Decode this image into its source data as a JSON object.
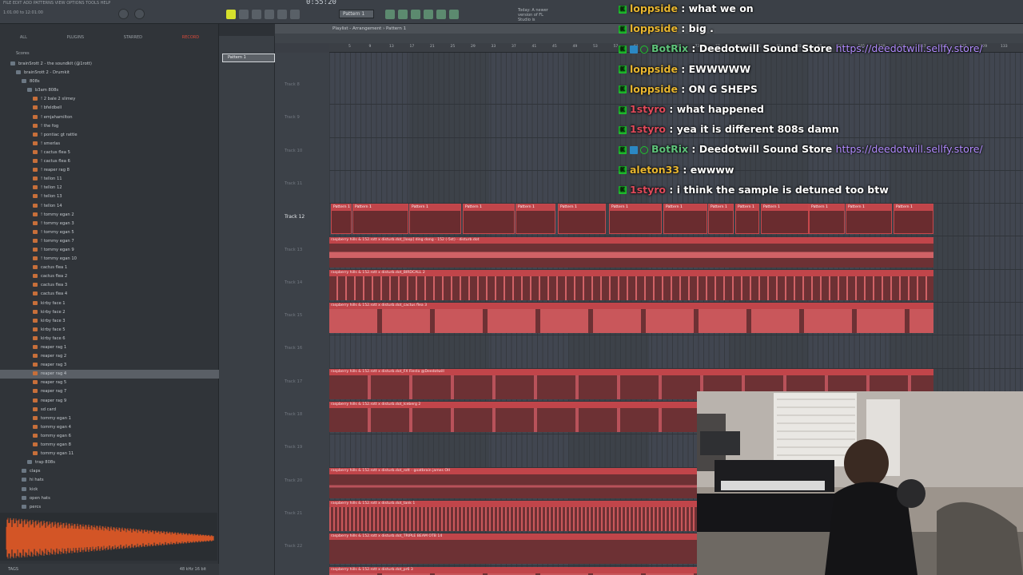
{
  "window": {
    "menu_text": "FILE EDIT ADD PATTERNS VIEW OPTIONS TOOLS HELP",
    "time_display": "0:55:20",
    "pattern_selector": "Pattern 1",
    "snap": "Line",
    "clock_line1": "1:01:00 to 12:01:00",
    "tip_text": "Today: A newer version of FL Studio is"
  },
  "browser": {
    "tabs": [
      {
        "label": "ALL"
      },
      {
        "label": "PLUGINS"
      },
      {
        "label": "STARRED"
      },
      {
        "label": "RECORD"
      }
    ],
    "scores_label": "Scores",
    "tree": [
      {
        "label": "brainSrott 2 - the soundkit (@1rott)",
        "indent": 1,
        "type": "folder"
      },
      {
        "label": "brainSrott 2 - Drumkit",
        "indent": 2,
        "type": "folder"
      },
      {
        "label": "808s",
        "indent": 3,
        "type": "folder"
      },
      {
        "label": "b3am 808s",
        "indent": 4,
        "type": "folder"
      },
      {
        "label": "! 2 bale 2 slimey",
        "indent": 5,
        "type": "wav"
      },
      {
        "label": "! bfeldbell",
        "indent": 5,
        "type": "wav"
      },
      {
        "label": "! emjahamilton",
        "indent": 5,
        "type": "wav"
      },
      {
        "label": "! the fog",
        "indent": 5,
        "type": "wav"
      },
      {
        "label": "! pontiac gt rattle",
        "indent": 5,
        "type": "wav"
      },
      {
        "label": "! smerlas",
        "indent": 5,
        "type": "wav"
      },
      {
        "label": "! cactus flea 5",
        "indent": 5,
        "type": "wav"
      },
      {
        "label": "! cactus flea 6",
        "indent": 5,
        "type": "wav"
      },
      {
        "label": "! reaper rag 8",
        "indent": 5,
        "type": "wav"
      },
      {
        "label": "! tellon 11",
        "indent": 5,
        "type": "wav"
      },
      {
        "label": "! tellon 12",
        "indent": 5,
        "type": "wav"
      },
      {
        "label": "! tellon 13",
        "indent": 5,
        "type": "wav"
      },
      {
        "label": "! tellon 14",
        "indent": 5,
        "type": "wav"
      },
      {
        "label": "! tommy egan 2",
        "indent": 5,
        "type": "wav"
      },
      {
        "label": "! tommy egan 3",
        "indent": 5,
        "type": "wav"
      },
      {
        "label": "! tommy egan 5",
        "indent": 5,
        "type": "wav"
      },
      {
        "label": "! tommy egan 7",
        "indent": 5,
        "type": "wav"
      },
      {
        "label": "! tommy egan 9",
        "indent": 5,
        "type": "wav"
      },
      {
        "label": "! tommy egan 10",
        "indent": 5,
        "type": "wav"
      },
      {
        "label": "cactus flea 1",
        "indent": 5,
        "type": "wav"
      },
      {
        "label": "cactus flea 2",
        "indent": 5,
        "type": "wav"
      },
      {
        "label": "cactus flea 3",
        "indent": 5,
        "type": "wav"
      },
      {
        "label": "cactus flea 4",
        "indent": 5,
        "type": "wav"
      },
      {
        "label": "kirby face 1",
        "indent": 5,
        "type": "wav"
      },
      {
        "label": "kirby face 2",
        "indent": 5,
        "type": "wav"
      },
      {
        "label": "kirby face 3",
        "indent": 5,
        "type": "wav"
      },
      {
        "label": "kirby face 5",
        "indent": 5,
        "type": "wav"
      },
      {
        "label": "kirby face 6",
        "indent": 5,
        "type": "wav"
      },
      {
        "label": "reaper rag 1",
        "indent": 5,
        "type": "wav"
      },
      {
        "label": "reaper rag 2",
        "indent": 5,
        "type": "wav"
      },
      {
        "label": "reaper rag 3",
        "indent": 5,
        "type": "wav"
      },
      {
        "label": "reaper rag 4",
        "indent": 5,
        "type": "wav",
        "selected": true
      },
      {
        "label": "reaper rag 5",
        "indent": 5,
        "type": "wav"
      },
      {
        "label": "reaper rag 7",
        "indent": 5,
        "type": "wav"
      },
      {
        "label": "reaper rag 9",
        "indent": 5,
        "type": "wav"
      },
      {
        "label": "sd card",
        "indent": 5,
        "type": "wav"
      },
      {
        "label": "tommy egan 1",
        "indent": 5,
        "type": "wav"
      },
      {
        "label": "tommy egan 4",
        "indent": 5,
        "type": "wav"
      },
      {
        "label": "tommy egan 6",
        "indent": 5,
        "type": "wav"
      },
      {
        "label": "tommy egan 8",
        "indent": 5,
        "type": "wav"
      },
      {
        "label": "tommy egan 11",
        "indent": 5,
        "type": "wav"
      },
      {
        "label": "trap 808s",
        "indent": 4,
        "type": "folder"
      },
      {
        "label": "claps",
        "indent": 3,
        "type": "folder"
      },
      {
        "label": "hi hats",
        "indent": 3,
        "type": "folder"
      },
      {
        "label": "kick",
        "indent": 3,
        "type": "folder"
      },
      {
        "label": "open hats",
        "indent": 3,
        "type": "folder"
      },
      {
        "label": "percs",
        "indent": 3,
        "type": "folder"
      }
    ],
    "footer_label": "TAGS",
    "footer_right": "48 kHz 16 bit"
  },
  "pattern_panel": {
    "item": "Pattern 1"
  },
  "playlist": {
    "title": "Playlist - Arrangement › Pattern 1",
    "ruler": [
      "5",
      "9",
      "13",
      "17",
      "21",
      "25",
      "29",
      "33",
      "37",
      "41",
      "45",
      "49",
      "53",
      "57",
      "61",
      "65",
      "69",
      "73",
      "77",
      "81",
      "85",
      "89",
      "93",
      "97",
      "101",
      "105",
      "109",
      "113",
      "117",
      "121",
      "125",
      "129",
      "133"
    ],
    "tracks": [
      {
        "label": "Track 8"
      },
      {
        "label": "Track 9"
      },
      {
        "label": "Track 10"
      },
      {
        "label": "Track 11"
      },
      {
        "label": "Track 12",
        "active": true
      },
      {
        "label": "Track 13"
      },
      {
        "label": "Track 14"
      },
      {
        "label": "Track 15"
      },
      {
        "label": "Track 16"
      },
      {
        "label": "Track 17"
      },
      {
        "label": "Track 18"
      },
      {
        "label": "Track 19"
      },
      {
        "label": "Track 20"
      },
      {
        "label": "Track 21"
      },
      {
        "label": "Track 22"
      },
      {
        "label": "Track 23"
      }
    ],
    "pattern_clip_label": "Pattern 1",
    "audio_clips": [
      {
        "track": 13,
        "label": "raspberry hills & 152.rott x disturb.dot_[loop] ding dong - 152 (-5st) - disturb.dot",
        "style": "dense"
      },
      {
        "track": 14,
        "label": "raspberry hills & 152.rott x disturb.dot_BIRDCALL 2",
        "style": "spiky"
      },
      {
        "track": 15,
        "label": "raspberry hills & 152.rott x disturb.dot_cactus flea 3",
        "style": "block"
      },
      {
        "track": 17,
        "label": "raspberry hills & 152.rott x disturb.dot_FX Fiesta @Deedotwill",
        "style": "sparse"
      },
      {
        "track": 18,
        "label": "raspberry hills & 152.rott x disturb.dot_Iceberg 2",
        "style": "dots"
      },
      {
        "track": 20,
        "label": "raspberry hills & 152.rott x disturb.dot_rott - goatbrain james OH",
        "style": "dashes"
      },
      {
        "track": 21,
        "label": "raspberry hills & 152.rott x disturb.dot_tank 1",
        "style": "dense2"
      },
      {
        "track": 22,
        "label": "raspberry hills & 152.rott x disturb.dot_TRIPLE BEAM OTB 14",
        "style": "blob"
      },
      {
        "track": 23,
        "label": "raspberry hills & 152.rott x disturb.dot_pr6 3",
        "style": "block"
      }
    ]
  },
  "chat": [
    {
      "user": "loppside",
      "color": "#e9b730",
      "text": "what we on",
      "badges": 1
    },
    {
      "user": "loppside",
      "color": "#e9b730",
      "text": "big .",
      "badges": 1
    },
    {
      "user": "BotRix",
      "color": "#ffffff",
      "text": "Deedotwill Sound Store",
      "link": "https://deedotwill.sellfy.store/",
      "badges": 3
    },
    {
      "user": "loppside",
      "color": "#e9b730",
      "text": "EWWWWW",
      "badges": 1
    },
    {
      "user": "loppside",
      "color": "#e9b730",
      "text": "ON G SHEPS",
      "badges": 1
    },
    {
      "user": "1styro",
      "color": "#e04a5a",
      "text": "what happened",
      "badges": 1
    },
    {
      "user": "1styro",
      "color": "#e04a5a",
      "text": "yea it is different 808s damn",
      "badges": 1
    },
    {
      "user": "BotRix",
      "color": "#ffffff",
      "text": "Deedotwill Sound Store",
      "link": "https://deedotwill.sellfy.store/",
      "badges": 3
    },
    {
      "user": "aleton33",
      "color": "#e9b730",
      "text": "ewwww",
      "badges": 1
    },
    {
      "user": "1styro",
      "color": "#e04a5a",
      "text": "i think the sample is detuned too btw",
      "badges": 1
    }
  ],
  "colors": {
    "accent": "#d6e02c",
    "clip": "#c1454a",
    "chat_badge": "#1fc52e",
    "link": "#b28cff"
  }
}
